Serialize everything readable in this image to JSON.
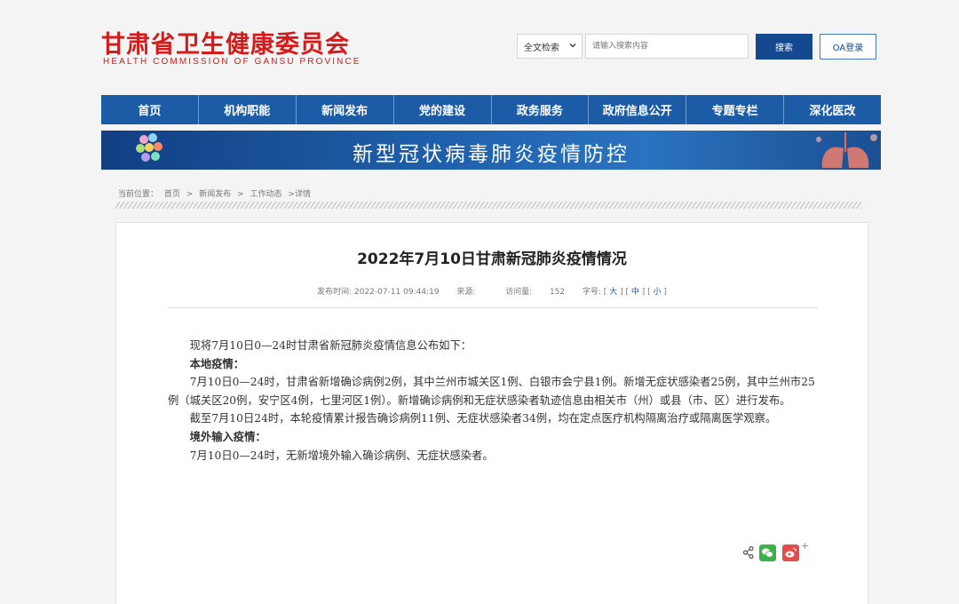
{
  "header": {
    "logo_cn": "甘肃省卫生健康委员会",
    "logo_en": "HEALTH  COMMISSION  OF  GANSU  PROVINCE"
  },
  "search": {
    "scope": "全文检索",
    "placeholder": "请输入搜索内容",
    "button": "搜索",
    "oa_button": "OA登录"
  },
  "nav": {
    "items": [
      "首页",
      "机构职能",
      "新闻发布",
      "党的建设",
      "政务服务",
      "政府信息公开",
      "专题专栏",
      "深化医改"
    ]
  },
  "banner": {
    "title": "新型冠状病毒肺炎疫情防控"
  },
  "breadcrumb": {
    "label": "当前位置：",
    "items": [
      "首页",
      ">",
      "新闻发布",
      ">",
      "工作动态",
      ">详情"
    ]
  },
  "article": {
    "title": "2022年7月10日甘肃新冠肺炎疫情情况",
    "meta": {
      "publish_label": "发布时间:",
      "publish_time": "2022-07-11 09:44:19",
      "source_label": "来源:",
      "views_label": "访问量:",
      "views": "152",
      "font_label": "字号:",
      "font_open": "[",
      "font_large": "大",
      "font_sep1": "] [",
      "font_medium": "中",
      "font_sep2": "] [",
      "font_small": "小",
      "font_close": "]"
    },
    "paragraphs": [
      {
        "text": "现将7月10日0—24时甘肃省新冠肺炎疫情信息公布如下：",
        "bold": false
      },
      {
        "text": "本地疫情：",
        "bold": true
      },
      {
        "text": "7月10日0—24时，甘肃省新增确诊病例2例，其中兰州市城关区1例、白银市会宁县1例。新增无症状感染者25例，其中兰州市25例（城关区20例，安宁区4例，七里河区1例）。新增确诊病例和无症状感染者轨迹信息由相关市（州）或县（市、区）进行发布。",
        "bold": false
      },
      {
        "text": "截至7月10日24时，本轮疫情累计报告确诊病例11例、无症状感染者34例，均在定点医疗机构隔离治疗或隔离医学观察。",
        "bold": false
      },
      {
        "text": "境外输入疫情：",
        "bold": true
      },
      {
        "text": "7月10日0—24时，无新增境外输入确诊病例、无症状感染者。",
        "bold": false
      }
    ]
  },
  "share": {
    "plus": "+",
    "icons": [
      "share-icon",
      "wechat-icon",
      "weibo-icon",
      "plus-icon"
    ]
  },
  "colors": {
    "brand_red": "#d41b1b",
    "nav_blue": "#1c5ba6",
    "button_blue": "#15498f"
  }
}
